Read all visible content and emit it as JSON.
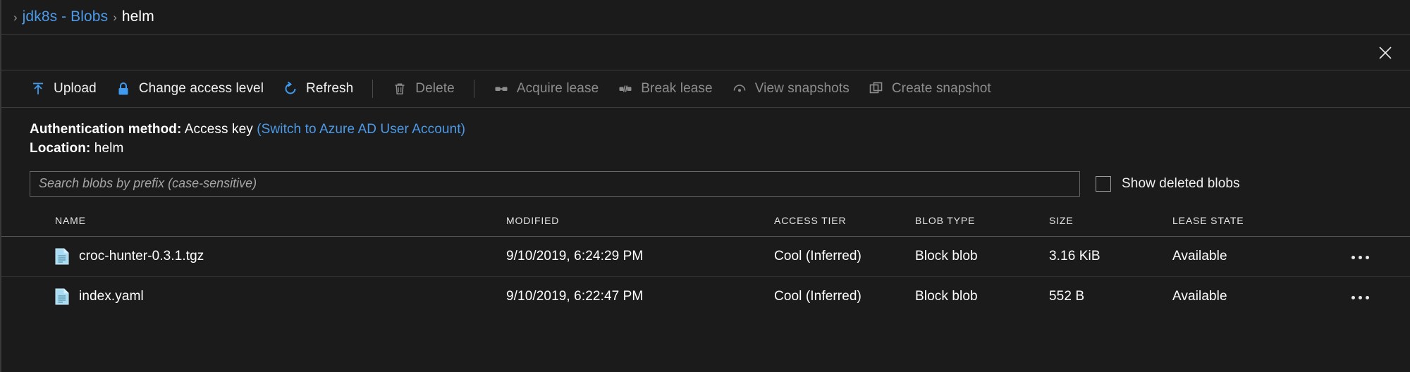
{
  "breadcrumb": {
    "separator": "›",
    "parent": "jdk8s - Blobs",
    "current": "helm"
  },
  "window": {
    "close_label": "Close",
    "close_icon": "close-icon"
  },
  "toolbar": {
    "items": [
      {
        "label": "Upload",
        "icon": "upload-icon",
        "enabled": true,
        "separator_after": false
      },
      {
        "label": "Change access level",
        "icon": "lock-icon",
        "enabled": true,
        "separator_after": false
      },
      {
        "label": "Refresh",
        "icon": "refresh-icon",
        "enabled": true,
        "separator_after": true
      },
      {
        "label": "Delete",
        "icon": "trash-icon",
        "enabled": false,
        "separator_after": true
      },
      {
        "label": "Acquire lease",
        "icon": "acquire-lease-icon",
        "enabled": false,
        "separator_after": false
      },
      {
        "label": "Break lease",
        "icon": "break-lease-icon",
        "enabled": false,
        "separator_after": false
      },
      {
        "label": "View snapshots",
        "icon": "view-snapshots-icon",
        "enabled": false,
        "separator_after": false
      },
      {
        "label": "Create snapshot",
        "icon": "create-snapshot-icon",
        "enabled": false,
        "separator_after": false
      }
    ]
  },
  "info": {
    "auth_label": "Authentication method:",
    "auth_value": "Access key",
    "auth_switch_link": "(Switch to Azure AD User Account)",
    "location_label": "Location:",
    "location_value": "helm"
  },
  "search": {
    "placeholder": "Search blobs by prefix (case-sensitive)",
    "value": "",
    "show_deleted_label": "Show deleted blobs",
    "show_deleted_checked": false
  },
  "table": {
    "columns": [
      "Name",
      "Modified",
      "Access tier",
      "Blob type",
      "Size",
      "Lease state",
      ""
    ],
    "rows": [
      {
        "name": "croc-hunter-0.3.1.tgz",
        "icon": "file-icon",
        "modified": "9/10/2019, 6:24:29 PM",
        "access_tier": "Cool (Inferred)",
        "blob_type": "Block blob",
        "size": "3.16 KiB",
        "lease_state": "Available",
        "menu": "···"
      },
      {
        "name": "index.yaml",
        "icon": "file-icon",
        "modified": "9/10/2019, 6:22:47 PM",
        "access_tier": "Cool (Inferred)",
        "blob_type": "Block blob",
        "size": "552 B",
        "lease_state": "Available",
        "menu": "···"
      }
    ]
  },
  "colors": {
    "background": "#1b1b1b",
    "link": "#4c9ae8",
    "accent": "#0f8de8",
    "text": "#ffffff",
    "disabled_text": "#8d8d8d",
    "file_icon": "#9fd8f0"
  }
}
